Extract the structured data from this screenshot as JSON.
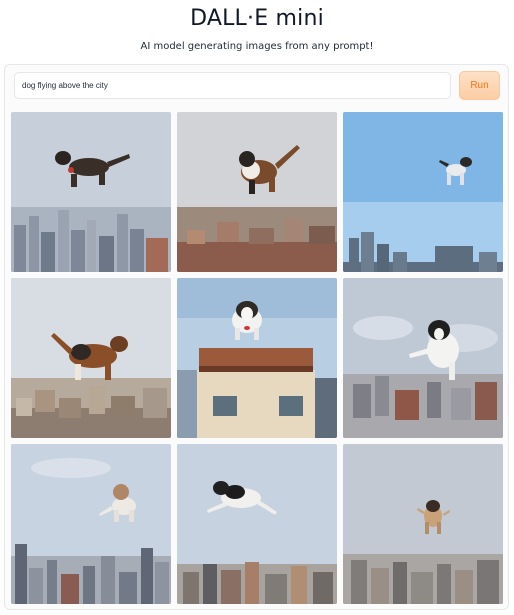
{
  "app": {
    "title": "DALL·E mini",
    "subtitle": "AI model generating images from any prompt!"
  },
  "prompt": {
    "value": "dog flying above the city"
  },
  "run_button": {
    "label": "Run",
    "color": "#f97316"
  },
  "gallery": {
    "columns": 3,
    "rows": 3,
    "images": [
      {
        "subject": "dog-flying-over-city"
      },
      {
        "subject": "dog-flying-over-city"
      },
      {
        "subject": "dog-flying-over-city"
      },
      {
        "subject": "dog-flying-over-city"
      },
      {
        "subject": "dog-flying-over-city"
      },
      {
        "subject": "dog-flying-over-city"
      },
      {
        "subject": "dog-flying-over-city"
      },
      {
        "subject": "dog-flying-over-city"
      },
      {
        "subject": "dog-flying-over-city"
      }
    ]
  }
}
